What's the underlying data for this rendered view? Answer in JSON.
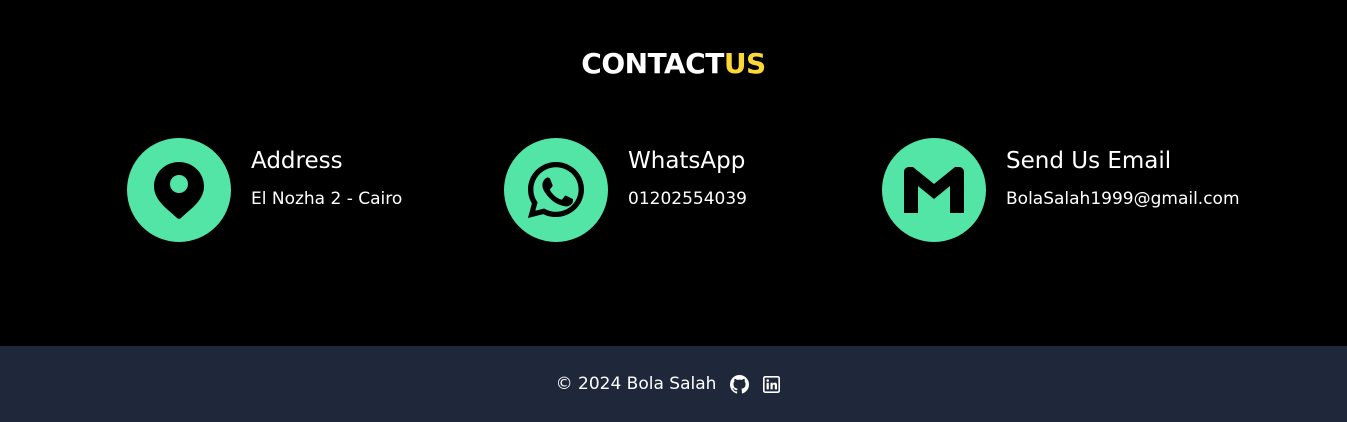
{
  "contact": {
    "title_main": "CONTACT",
    "title_accent": "US",
    "cards": [
      {
        "icon": "map-pin-icon",
        "heading": "Address",
        "value": "El Nozha 2 - Cairo"
      },
      {
        "icon": "whatsapp-icon",
        "heading": "WhatsApp",
        "value": "01202554039"
      },
      {
        "icon": "gmail-icon",
        "heading": "Send Us Email",
        "value": "BolaSalah1999@gmail.com"
      }
    ]
  },
  "footer": {
    "copyright": "© 2024 Bola Salah",
    "links": [
      {
        "icon": "github-icon"
      },
      {
        "icon": "linkedin-icon"
      }
    ]
  },
  "colors": {
    "background": "#000000",
    "accent_green": "#52e5a5",
    "accent_yellow": "#fdd835",
    "footer_bg": "#1f283a",
    "text": "#ffffff"
  }
}
